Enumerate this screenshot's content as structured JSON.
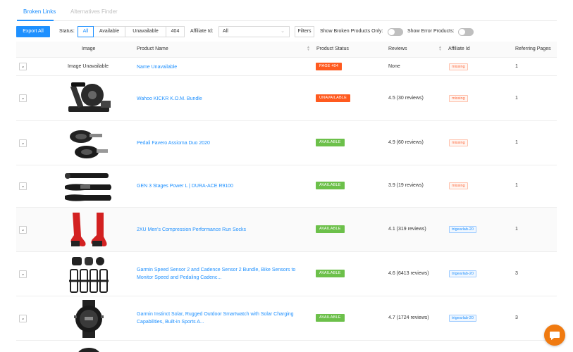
{
  "tabs": [
    {
      "label": "Broken Links",
      "active": true
    },
    {
      "label": "Alternatives Finder",
      "active": false
    }
  ],
  "toolbar": {
    "export_label": "Export All",
    "status_label": "Status:",
    "status_options": [
      "All",
      "Available",
      "Unavailable",
      "404"
    ],
    "status_selected": "All",
    "affiliate_label": "Affiliate Id:",
    "affiliate_value": "All",
    "filters_label": "Filters",
    "toggle_broken_label": "Show Broken Products Only:",
    "toggle_error_label": "Show Error Products:"
  },
  "table": {
    "columns": [
      "Image",
      "Product Name",
      "Product Status",
      "Reviews",
      "Affiliate Id",
      "Referring Pages"
    ],
    "rows": [
      {
        "image": "Image Unavailable",
        "image_icon": "none",
        "name": [
          "Name Unavailable"
        ],
        "status": "PAGE 404",
        "status_kind": "err",
        "reviews": "None",
        "affiliate": "missing",
        "affiliate_kind": "missing",
        "pages": "1"
      },
      {
        "image": "",
        "image_icon": "bike-trainer-icon",
        "name": [
          "Wahoo KICKR K.O.M. Bundle"
        ],
        "status": "UNAVAILABLE",
        "status_kind": "err",
        "reviews": "4.5 (30 reviews)",
        "affiliate": "missing",
        "affiliate_kind": "missing",
        "pages": "1"
      },
      {
        "image": "",
        "image_icon": "pedals-icon",
        "name": [
          "Pedali Favero Assioma Duo 2020"
        ],
        "status": "AVAILABLE",
        "status_kind": "ok",
        "reviews": "4.9 (60 reviews)",
        "affiliate": "missing",
        "affiliate_kind": "missing",
        "pages": "1"
      },
      {
        "image": "",
        "image_icon": "crank-arms-icon",
        "name": [
          "GEN 3 Stages Power L | DURA-ACE R9100"
        ],
        "status": "AVAILABLE",
        "status_kind": "ok",
        "reviews": "3.9 (19 reviews)",
        "affiliate": "missing",
        "affiliate_kind": "missing",
        "pages": "1"
      },
      {
        "image": "",
        "image_icon": "socks-icon",
        "name": [
          "2XU Men's Compression Performance Run Socks"
        ],
        "status": "AVAILABLE",
        "status_kind": "ok",
        "reviews": "4.1 (319 reviews)",
        "affiliate": "trigearlab-20",
        "affiliate_kind": "ok",
        "pages": "1"
      },
      {
        "image": "",
        "image_icon": "sensors-icon",
        "name": [
          "Garmin Speed Sensor 2 and Cadence Sensor 2 Bundle, Bike Sensors to",
          "Monitor Speed and Pedaling Cadenc..."
        ],
        "status": "AVAILABLE",
        "status_kind": "ok",
        "reviews": "4.6 (6413 reviews)",
        "affiliate": "trigearlab-20",
        "affiliate_kind": "ok",
        "pages": "3"
      },
      {
        "image": "",
        "image_icon": "smartwatch-icon",
        "name": [
          "Garmin Instinct Solar, Rugged Outdoor Smartwatch with Solar Charging",
          "Capabilities, Built-in Sports A..."
        ],
        "status": "AVAILABLE",
        "status_kind": "ok",
        "reviews": "4.7 (1724 reviews)",
        "affiliate": "trigearlab-20",
        "affiliate_kind": "ok",
        "pages": "3"
      }
    ]
  },
  "colors": {
    "accent": "#1e90ff",
    "error": "#ff5a1f",
    "success": "#6cc04a",
    "chat": "#f07a10"
  }
}
